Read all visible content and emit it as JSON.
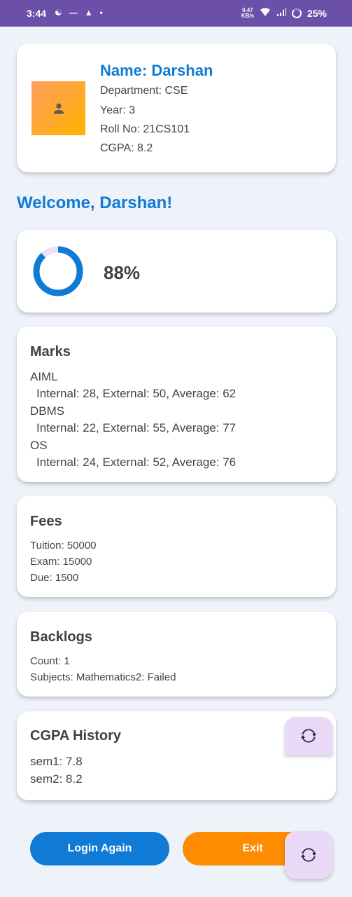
{
  "status_bar": {
    "time": "3:44",
    "net_speed_top": "0.47",
    "net_speed_bottom": "KB/s",
    "battery": "25%"
  },
  "profile": {
    "name": "Name: Darshan",
    "department": "Department: CSE",
    "year": "Year: 3",
    "roll_no": "Roll No: 21CS101",
    "cgpa": "CGPA: 8.2"
  },
  "welcome": "Welcome, Darshan!",
  "attendance": {
    "percent_label": "88%",
    "fraction": 0.88,
    "color": "#0f7bd6",
    "track_color": "#ece1f6"
  },
  "marks": {
    "title": "Marks",
    "subjects": [
      {
        "name": "AIML",
        "detail": "Internal: 28, External: 50, Average: 62"
      },
      {
        "name": "DBMS",
        "detail": "Internal: 22, External: 55, Average: 77"
      },
      {
        "name": "OS",
        "detail": "Internal: 24, External: 52, Average: 76"
      }
    ]
  },
  "fees": {
    "title": "Fees",
    "tuition": "Tuition: 50000",
    "exam": "Exam: 15000",
    "due": "Due: 1500"
  },
  "backlogs": {
    "title": "Backlogs",
    "count": "Count: 1",
    "subjects": "Subjects: Mathematics2: Failed"
  },
  "cgpa_history": {
    "title": "CGPA History",
    "items": [
      "sem1: 7.8",
      "sem2: 8.2"
    ]
  },
  "buttons": {
    "login_again": "Login Again",
    "exit": "Exit"
  },
  "icons": {
    "refresh": "refresh-icon",
    "avatar": "person-icon"
  },
  "colors": {
    "accent": "#0f7bd6",
    "exit": "#ff8c00",
    "status_bar": "#6b4fa8",
    "fab": "#ead9f7"
  }
}
